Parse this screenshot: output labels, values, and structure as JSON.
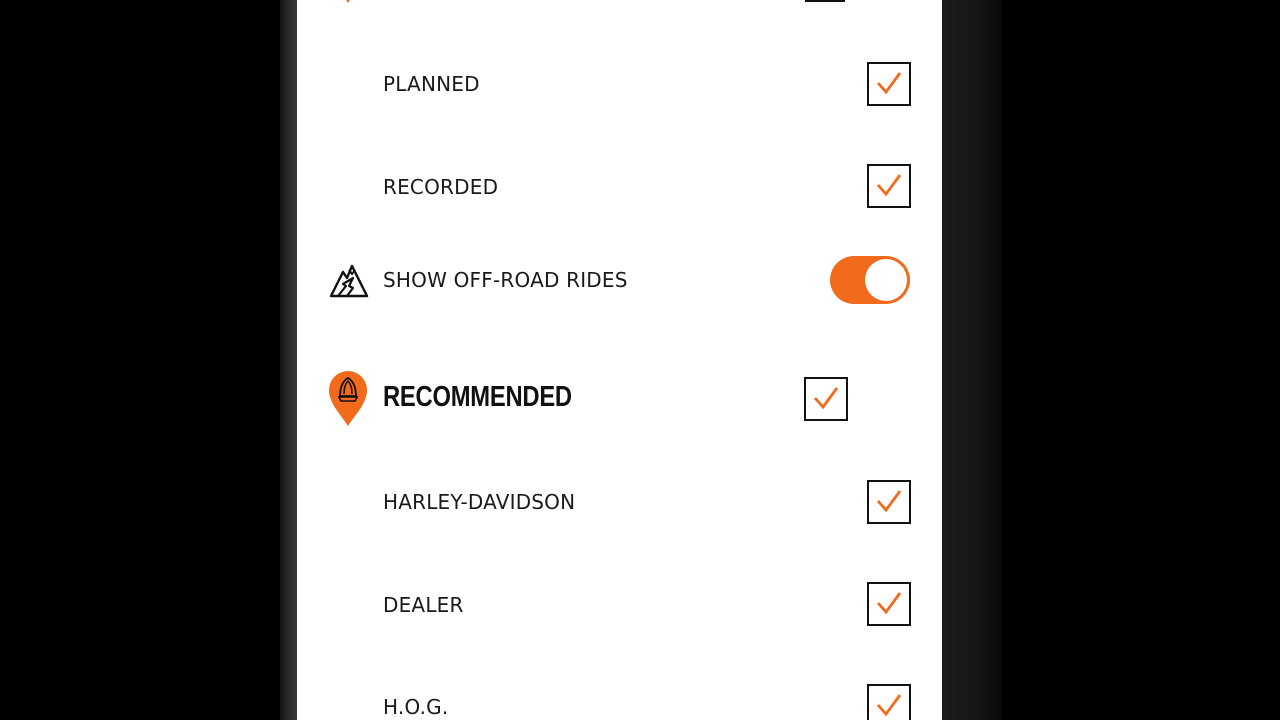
{
  "filters": {
    "items": [
      {
        "label": "PLANNED",
        "checked": true
      },
      {
        "label": "RECORDED",
        "checked": true
      }
    ],
    "offroad": {
      "label": "SHOW OFF-ROAD RIDES",
      "on": true,
      "icon": "mountain-offroad-icon"
    },
    "recommended": {
      "title": "RECOMMENDED",
      "checked": true,
      "icon": "recommended-pin-icon",
      "items": [
        {
          "label": "HARLEY-DAVIDSON",
          "checked": true
        },
        {
          "label": "DEALER",
          "checked": true
        },
        {
          "label": "H.O.G.",
          "checked": true
        }
      ]
    }
  },
  "colors": {
    "accent": "#f26a1b",
    "text": "#1a1a1a",
    "panel": "#ffffff"
  }
}
